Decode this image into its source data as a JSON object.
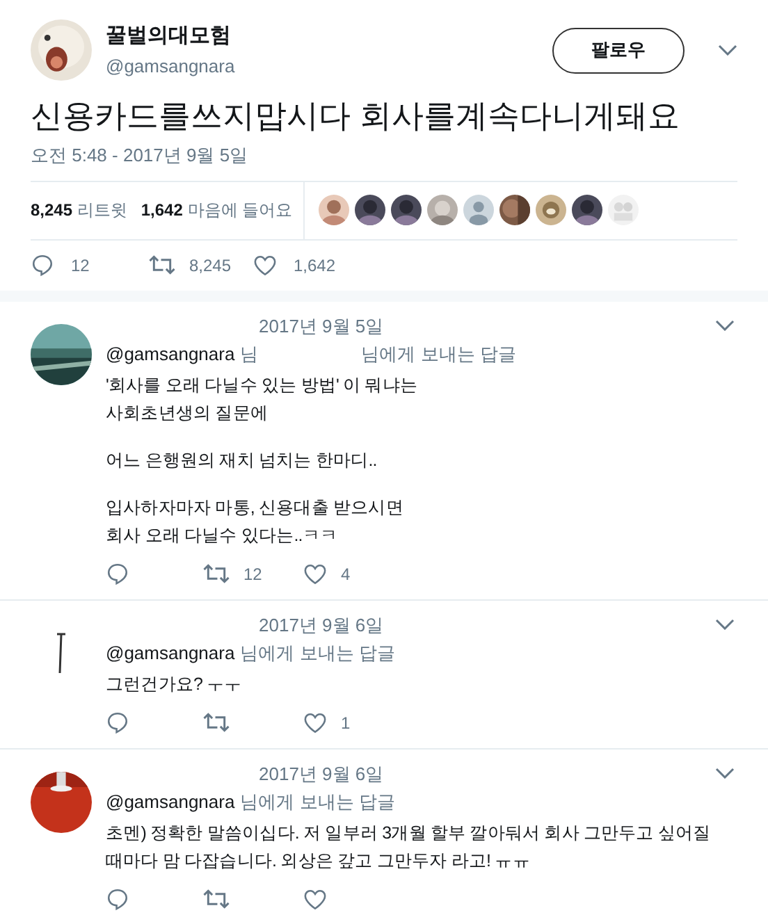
{
  "tweet": {
    "name": "꿀벌의대모험",
    "handle": "@gamsangnara",
    "follow_button": "팔로우",
    "text": "신용카드를쓰지맙시다 회사를계속다니게돼요",
    "time": "오전 5:48 - 2017년 9월 5일",
    "retweets": {
      "count": "8,245",
      "label": "리트윗"
    },
    "likes": {
      "count": "1,642",
      "label": "마음에 들어요"
    },
    "actions": {
      "replies": "12",
      "retweets": "8,245",
      "likes": "1,642"
    }
  },
  "replies": [
    {
      "date": "2017년 9월 5일",
      "reply_to": "@gamsangnara",
      "reply_to_suffix": "님",
      "redacted": true,
      "label": "님에게 보내는 답글",
      "paragraphs": [
        "'회사를 오래 다닐수 있는 방법' 이 뭐냐는\n사회초년생의 질문에",
        "어느 은행원의 재치 넘치는 한마디..",
        "입사하자마자 마통, 신용대출 받으시면\n회사 오래 다닐수 있다는..ㅋㅋ"
      ],
      "actions": {
        "retweets": "12",
        "likes": "4"
      }
    },
    {
      "date": "2017년 9월 6일",
      "reply_to": "@gamsangnara",
      "redacted": false,
      "label": "님에게 보내는 답글",
      "paragraphs": [
        "그런건가요?  ㅜㅜ"
      ],
      "actions": {
        "likes": "1"
      }
    },
    {
      "date": "2017년 9월 6일",
      "reply_to": "@gamsangnara",
      "redacted": false,
      "label": "님에게 보내는 답글",
      "paragraphs": [
        "초멘) 정확한 말씀이십다. 저 일부러 3개월 할부 깔아둬서 회사 그만두고 싶어질\n때마다 맘 다잡습니다. 외상은 갚고 그만두자 라고! ㅠㅠ"
      ]
    }
  ]
}
